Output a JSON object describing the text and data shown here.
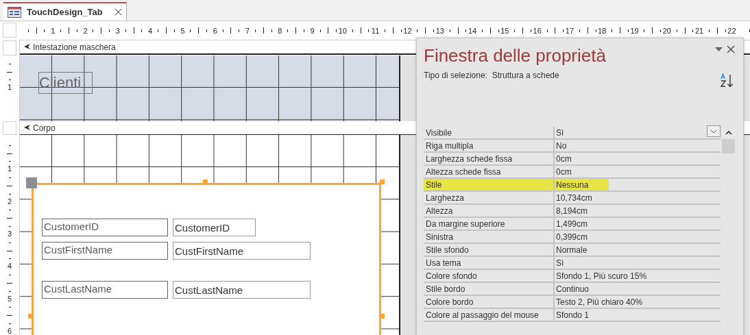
{
  "document_tab": {
    "title": "TouchDesign_Tab",
    "selected": true
  },
  "ruler": {
    "horizontal": [
      "1",
      "2",
      "3",
      "4",
      "5",
      "6",
      "7",
      "8",
      "9",
      "10",
      "11",
      "12",
      "13",
      "14",
      "15",
      "16",
      "17",
      "18",
      "19",
      "20",
      "21",
      "22"
    ],
    "header_vertical": [
      "1"
    ],
    "body_vertical": [
      "1",
      "2",
      "3",
      "4",
      "5",
      "6"
    ]
  },
  "sections": [
    {
      "title": "Intestazione maschera",
      "kind": "header"
    },
    {
      "title": "Corpo",
      "kind": "body"
    }
  ],
  "header_label": "Clienti",
  "tab_control": {
    "selected": true,
    "fields": [
      {
        "label": "CustomerID",
        "value": "CustomerID"
      },
      {
        "label": "CustFirstName",
        "value": "CustFirstName"
      },
      {
        "label": "CustLastName",
        "value": "CustLastName"
      }
    ]
  },
  "property_sheet": {
    "title": "Finestra delle proprietà",
    "selection_label": "Tipo di selezione:",
    "selection_type": "Struttura a schede",
    "rows": [
      {
        "name": "Visibile",
        "value": "Sì",
        "selected": true,
        "highlighted": false
      },
      {
        "name": "Riga multipla",
        "value": "No",
        "selected": false,
        "highlighted": false
      },
      {
        "name": "Larghezza schede fissa",
        "value": "0cm",
        "selected": false,
        "highlighted": false
      },
      {
        "name": "Altezza schede fissa",
        "value": "0cm",
        "selected": false,
        "highlighted": false
      },
      {
        "name": "Stile",
        "value": "Nessuna",
        "selected": false,
        "highlighted": true
      },
      {
        "name": "Larghezza",
        "value": "10,734cm",
        "selected": false,
        "highlighted": false
      },
      {
        "name": "Altezza",
        "value": "8,194cm",
        "selected": false,
        "highlighted": false
      },
      {
        "name": "Da margine superiore",
        "value": "1,499cm",
        "selected": false,
        "highlighted": false
      },
      {
        "name": "Sinistra",
        "value": "0,399cm",
        "selected": false,
        "highlighted": false
      },
      {
        "name": "Stile sfondo",
        "value": "Normale",
        "selected": false,
        "highlighted": false
      },
      {
        "name": "Usa tema",
        "value": "Sì",
        "selected": false,
        "highlighted": false
      },
      {
        "name": "Colore sfondo",
        "value": "Sfondo 1, Più scuro 15%",
        "selected": false,
        "highlighted": false
      },
      {
        "name": "Stile bordo",
        "value": "Continuo",
        "selected": false,
        "highlighted": false
      },
      {
        "name": "Colore bordo",
        "value": "Testo 2, Più chiaro 40%",
        "selected": false,
        "highlighted": false
      },
      {
        "name": "Colore al passaggio del mouse",
        "value": "Sfondo 1",
        "selected": false,
        "highlighted": false
      }
    ]
  }
}
